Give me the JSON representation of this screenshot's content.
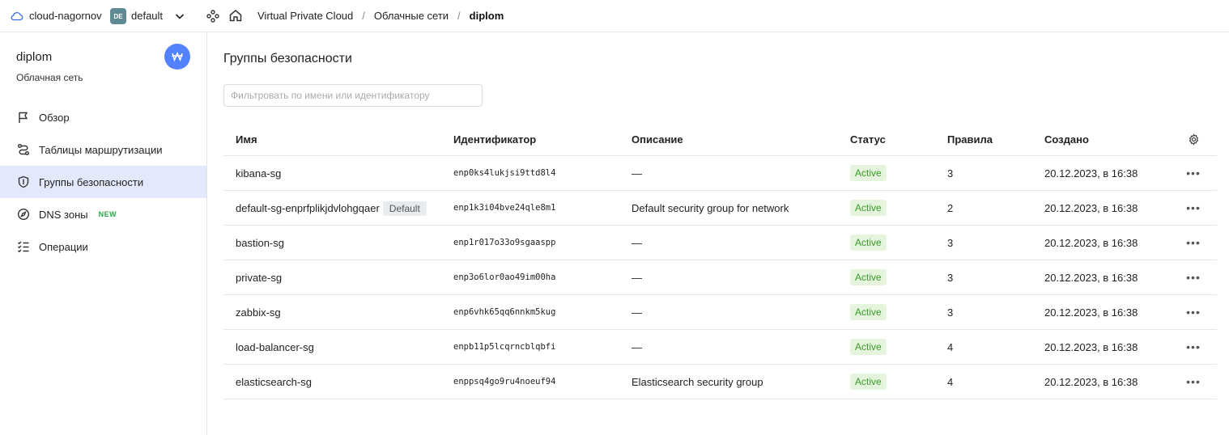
{
  "topbar": {
    "cloud_name": "cloud-nagornov",
    "folder_badge": "DE",
    "folder_name": "default",
    "breadcrumbs": [
      "Virtual Private Cloud",
      "Облачные сети",
      "diplom"
    ]
  },
  "sidebar": {
    "title": "diplom",
    "subtitle": "Облачная сеть",
    "items": [
      {
        "label": "Обзор",
        "icon": "flag-icon",
        "active": false
      },
      {
        "label": "Таблицы маршрутизации",
        "icon": "route-icon",
        "active": false
      },
      {
        "label": "Группы безопасности",
        "icon": "shield-icon",
        "active": true
      },
      {
        "label": "DNS зоны",
        "icon": "compass-icon",
        "active": false,
        "badge": "NEW"
      },
      {
        "label": "Операции",
        "icon": "list-icon",
        "active": false
      }
    ]
  },
  "main": {
    "title": "Группы безопасности",
    "filter_placeholder": "Фильтровать по имени или идентификатору",
    "columns": {
      "name": "Имя",
      "id": "Идентификатор",
      "description": "Описание",
      "status": "Статус",
      "rules": "Правила",
      "created": "Создано"
    },
    "rows": [
      {
        "name": "kibana-sg",
        "tag": "",
        "id": "enp0ks4lukjsi9ttd8l4",
        "description": "—",
        "status": "Active",
        "rules": "3",
        "created": "20.12.2023, в 16:38"
      },
      {
        "name": "default-sg-enprfplikjdvlohgqaer",
        "tag": "Default",
        "id": "enp1k3i04bve24qle8m1",
        "description": "Default security group for network",
        "status": "Active",
        "rules": "2",
        "created": "20.12.2023, в 16:38"
      },
      {
        "name": "bastion-sg",
        "tag": "",
        "id": "enp1r017o33o9sgaaspp",
        "description": "—",
        "status": "Active",
        "rules": "3",
        "created": "20.12.2023, в 16:38"
      },
      {
        "name": "private-sg",
        "tag": "",
        "id": "enp3o6lor0ao49im00ha",
        "description": "—",
        "status": "Active",
        "rules": "3",
        "created": "20.12.2023, в 16:38"
      },
      {
        "name": "zabbix-sg",
        "tag": "",
        "id": "enp6vhk65qq6nnkm5kug",
        "description": "—",
        "status": "Active",
        "rules": "3",
        "created": "20.12.2023, в 16:38"
      },
      {
        "name": "load-balancer-sg",
        "tag": "",
        "id": "enpb11p5lcqrncblqbfi",
        "description": "—",
        "status": "Active",
        "rules": "4",
        "created": "20.12.2023, в 16:38"
      },
      {
        "name": "elasticsearch-sg",
        "tag": "",
        "id": "enppsq4go9ru4noeuf94",
        "description": "Elasticsearch security group",
        "status": "Active",
        "rules": "4",
        "created": "20.12.2023, в 16:38"
      }
    ]
  },
  "colors": {
    "accent": "#5282ff",
    "active_nav_bg": "#e3e9fb",
    "status_bg": "#e5f5dd",
    "status_text": "#3a9a2a",
    "new_badge": "#2aa84a"
  }
}
